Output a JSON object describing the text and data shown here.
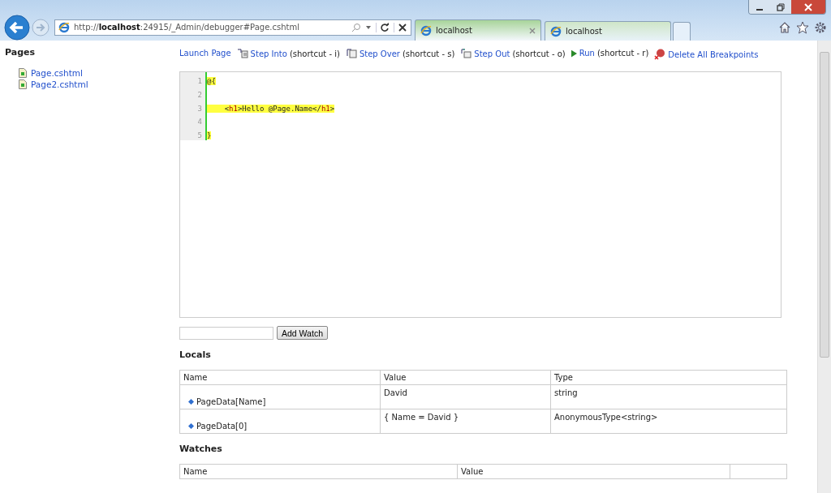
{
  "browser": {
    "address": "http://**localhost**:24915/_Admin/debugger#Page.cshtml",
    "tabs": [
      {
        "label": "localhost",
        "selected": true
      },
      {
        "label": "localhost",
        "selected": false
      }
    ]
  },
  "sidebar": {
    "title": "Pages",
    "items": [
      "Page.cshtml",
      "Page2.cshtml"
    ]
  },
  "toolbar": [
    {
      "kind": "launch",
      "label": "Launch Page"
    },
    {
      "kind": "step-into",
      "label": "Step Into",
      "shortcut": "(shortcut - i)"
    },
    {
      "kind": "step-over",
      "label": "Step Over",
      "shortcut": "(shortcut - s)"
    },
    {
      "kind": "step-out",
      "label": "Step Out",
      "shortcut": "(shortcut - o)"
    },
    {
      "kind": "run",
      "label": "Run",
      "shortcut": "(shortcut - r)"
    },
    {
      "kind": "delete",
      "label": "Delete All Breakpoints"
    }
  ],
  "editor": {
    "lines": [
      {
        "number": "1",
        "highlighted": true,
        "segments": [
          {
            "kind": "plain",
            "text": "@{"
          }
        ]
      },
      {
        "number": "2"
      },
      {
        "number": "3",
        "highlighted": true,
        "segments": [
          {
            "kind": "plain",
            "text": "    <"
          },
          {
            "kind": "tag",
            "text": "h1"
          },
          {
            "kind": "plain",
            "text": ">Hello @Page.Name</"
          },
          {
            "kind": "tag",
            "text": "h1"
          },
          {
            "kind": "plain",
            "text": ">"
          }
        ]
      },
      {
        "number": "4"
      },
      {
        "number": "5",
        "highlighted": true,
        "segments": [
          {
            "kind": "plain",
            "text": "}"
          }
        ]
      }
    ]
  },
  "watch_button": "Add Watch",
  "locals": {
    "title": "Locals",
    "columns": [
      "Name",
      "Value",
      "Type"
    ],
    "rows": [
      [
        "PageData[Name]",
        "David",
        "string"
      ],
      [
        "PageData[0]",
        "{ Name = David }",
        "AnonymousType<string>"
      ]
    ]
  },
  "watches": {
    "title": "Watches",
    "columns": [
      "Name",
      "Value"
    ]
  }
}
